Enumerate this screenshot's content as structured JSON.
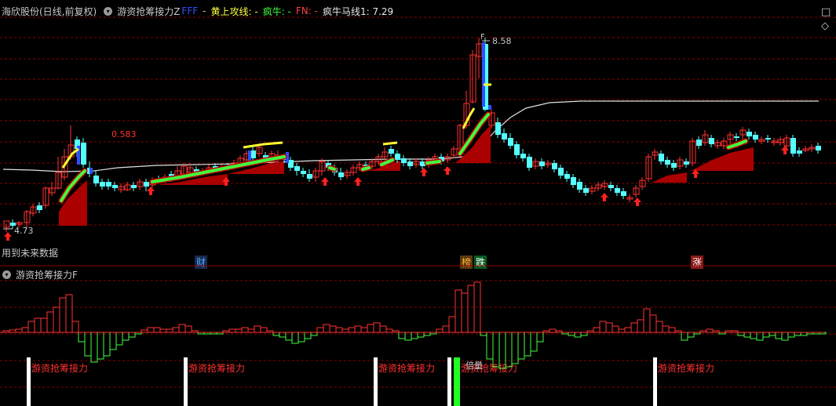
{
  "header": {
    "stock_name": "海欣股份(日线,前复权)",
    "indicator_main": "游资抢筹接力Z",
    "fff": "FFF",
    "dash1": "-",
    "huang": "黄上攻线: -",
    "fengniu": "疯牛: -",
    "fn": "FN: -",
    "mxian": "疯牛马线1: 7.29"
  },
  "window_controls": {
    "maximize_icon": "□",
    "diamond_icon": "◇"
  },
  "price_labels": {
    "high": "8.58",
    "high_marker": "F",
    "low": "4.73",
    "ratio": "0.583"
  },
  "future_text": "用到未来数据",
  "event_labels": [
    {
      "text": "财",
      "color": "#4aa8ff",
      "bg": "#1a2a50"
    },
    {
      "text": "榜",
      "color": "#ffb030",
      "bg": "#5a3a10"
    },
    {
      "text": "跌",
      "color": "#ffffff",
      "bg": "#0a5a20"
    },
    {
      "text": "涨",
      "color": "#ffffff",
      "bg": "#8a1a1a"
    }
  ],
  "sub_header": {
    "title": "游资抢筹接力F"
  },
  "sub_signal_label": "游资抢筹接力",
  "sub_overlap_label": "倍量",
  "colors": {
    "up": "#ff3232",
    "down": "#54ffff",
    "grid": "#8a0000",
    "yellow": "#ffff30",
    "green": "#40ff40"
  }
}
